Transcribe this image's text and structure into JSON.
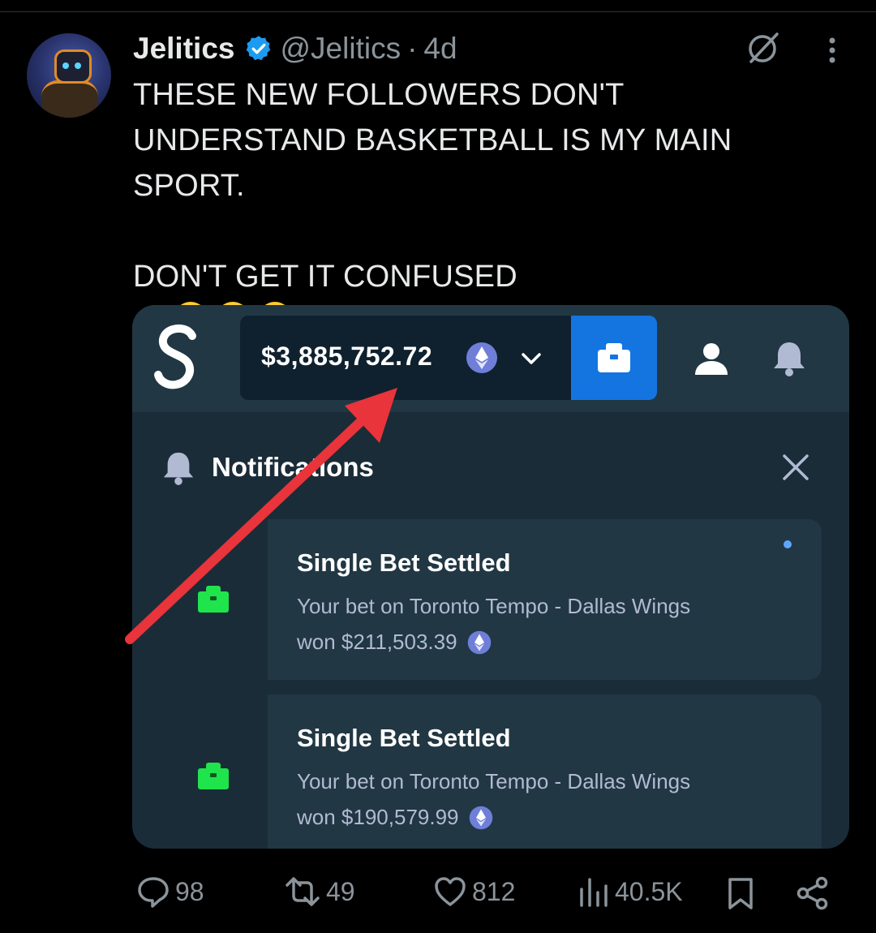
{
  "tweet": {
    "author_name": "Jelitics",
    "handle": "@Jelitics",
    "separator": "·",
    "time": "4d",
    "text_lines": [
      "THESE NEW FOLLOWERS DON'T",
      "UNDERSTAND BASKETBALL IS MY MAIN",
      "SPORT."
    ],
    "text_line2": "DON'T GET IT CONFUSED",
    "emojis": [
      "face-with-tears-of-joy",
      "face-with-tears-of-joy",
      "face-with-tears-of-joy"
    ]
  },
  "screenshot": {
    "logo": "S",
    "balance": "$3,885,752.72",
    "currency_icon": "ethereum-icon",
    "accent_color": "#1475e1",
    "notifications_title": "Notifications",
    "notifications": [
      {
        "title": "Single Bet Settled",
        "line1": "Your bet on Toronto Tempo - Dallas Wings",
        "line2": "won $211,503.39",
        "unread": true
      },
      {
        "title": "Single Bet Settled",
        "line1": "Your bet on Toronto Tempo - Dallas Wings",
        "line2": "won $190,579.99",
        "unread": false
      }
    ],
    "annotation_arrow_color": "#e8343a"
  },
  "actions": {
    "replies": "98",
    "reposts": "49",
    "likes": "812",
    "views": "40.5K"
  }
}
